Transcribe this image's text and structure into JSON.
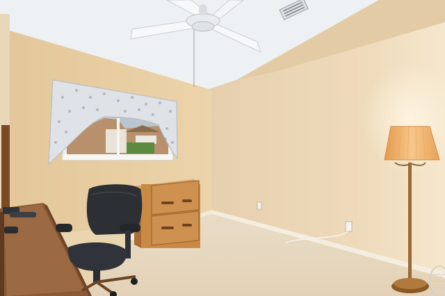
{
  "scene": {
    "description_free": true,
    "objects": [
      "ceiling-fan",
      "air-vent",
      "window-with-valance",
      "wooden-file-cabinet",
      "office-chair",
      "wooden-desk",
      "telephone",
      "floor-lamp",
      "electrical-outlet",
      "carpet-floor"
    ]
  },
  "colors": {
    "wall_left": "#e8cfa2",
    "wall_right": "#ecd7b6",
    "ceiling": "#eef1f4",
    "carpet": "#e6d8c0",
    "wood": "#c98a45",
    "desk": "#8a5a36",
    "chair": "#2c2f33",
    "lamp_shade": "#f1b36b"
  }
}
